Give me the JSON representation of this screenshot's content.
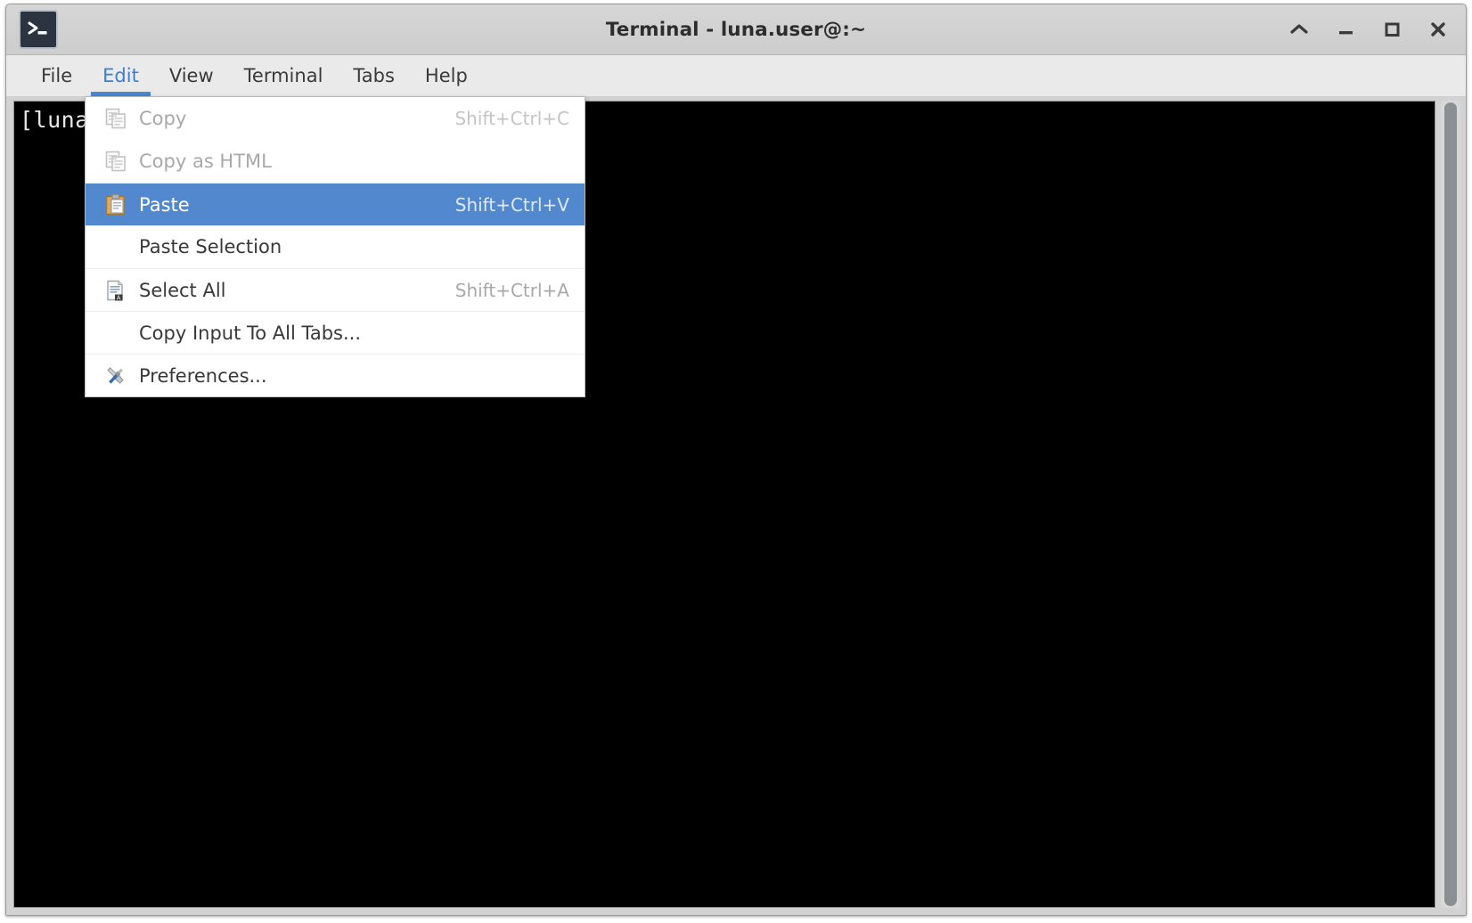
{
  "window": {
    "title": "Terminal - luna.user@:~",
    "app_icon": "terminal-icon",
    "colors": {
      "titlebar_bg": "#d2d2d2",
      "menubar_bg": "#eaeaea",
      "terminal_bg": "#000000",
      "accent": "#4a87d0",
      "menu_highlight": "#5289ce",
      "disabled_text": "#a9a9a9"
    },
    "controls": [
      {
        "name": "shade-button",
        "glyph": "chevron-up-icon"
      },
      {
        "name": "minimize-button",
        "glyph": "minimize-icon"
      },
      {
        "name": "maximize-button",
        "glyph": "maximize-icon"
      },
      {
        "name": "close-button",
        "glyph": "close-icon"
      }
    ]
  },
  "menubar": {
    "items": [
      {
        "label": "File",
        "active": false
      },
      {
        "label": "Edit",
        "active": true
      },
      {
        "label": "View",
        "active": false
      },
      {
        "label": "Terminal",
        "active": false
      },
      {
        "label": "Tabs",
        "active": false
      },
      {
        "label": "Help",
        "active": false
      }
    ]
  },
  "edit_menu": {
    "open": true,
    "items": [
      {
        "label": "Copy",
        "accel": "Shift+Ctrl+C",
        "icon": "copy-icon",
        "disabled": true,
        "selected": false,
        "separator_above": false
      },
      {
        "label": "Copy as HTML",
        "accel": "",
        "icon": "copy-html-icon",
        "disabled": true,
        "selected": false,
        "separator_above": false
      },
      {
        "label": "Paste",
        "accel": "Shift+Ctrl+V",
        "icon": "paste-icon",
        "disabled": false,
        "selected": true,
        "separator_above": true
      },
      {
        "label": "Paste Selection",
        "accel": "",
        "icon": "",
        "disabled": false,
        "selected": false,
        "separator_above": false
      },
      {
        "label": "Select All",
        "accel": "Shift+Ctrl+A",
        "icon": "select-all-icon",
        "disabled": false,
        "selected": false,
        "separator_above": true
      },
      {
        "label": "Copy Input To All Tabs...",
        "accel": "",
        "icon": "",
        "disabled": false,
        "selected": false,
        "separator_above": true
      },
      {
        "label": "Preferences...",
        "accel": "",
        "icon": "preferences-icon",
        "disabled": false,
        "selected": false,
        "separator_above": true
      }
    ]
  },
  "terminal": {
    "prompt_text": "[luna.user@ ~]$",
    "scrollbar_visible": true
  }
}
